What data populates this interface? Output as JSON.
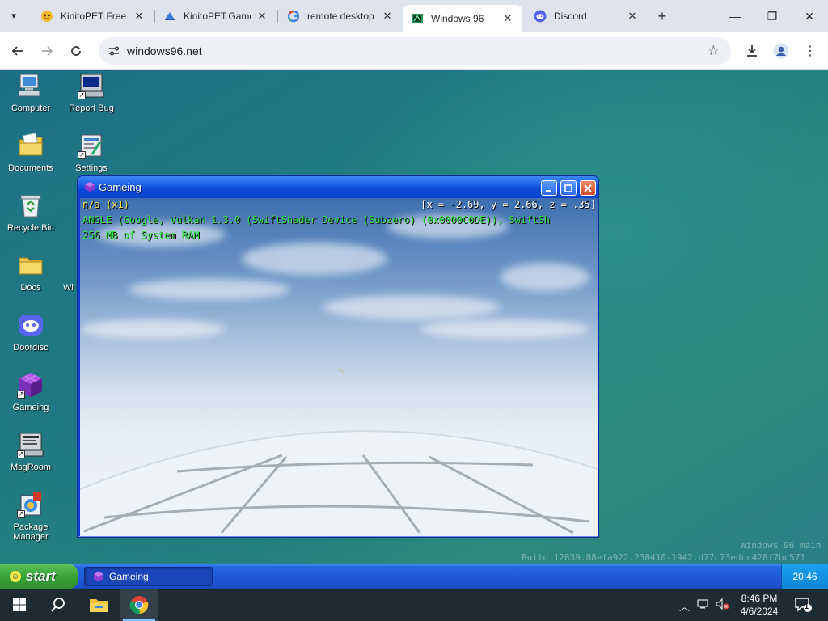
{
  "browser": {
    "tabs": [
      {
        "title": "KinitoPET Free",
        "icon": "kinitopet-favicon"
      },
      {
        "title": "KinitoPET.Game",
        "icon": "cloud-favicon"
      },
      {
        "title": "remote desktop",
        "icon": "google-favicon"
      },
      {
        "title": "Windows 96",
        "icon": "windows96-favicon",
        "active": true
      },
      {
        "title": "Discord",
        "icon": "discord-favicon"
      }
    ],
    "url": "windows96.net"
  },
  "desktop": {
    "icons": [
      {
        "label": "Computer",
        "icon": "computer-icon"
      },
      {
        "label": "Report Bug",
        "icon": "report-bug-icon"
      },
      {
        "label": "Documents",
        "icon": "documents-folder-icon"
      },
      {
        "label": "Settings",
        "icon": "settings-icon"
      },
      {
        "label": "Recycle Bin",
        "icon": "recycle-bin-icon"
      },
      {
        "label": "Docs",
        "icon": "folder-icon"
      },
      {
        "label": "Wi",
        "icon": "hidden-icon"
      },
      {
        "label": "Doordisc",
        "icon": "doordisc-icon"
      },
      {
        "label": "Gameing",
        "icon": "gameing-cube-icon"
      },
      {
        "label": "MsgRoom",
        "icon": "msgroom-icon"
      },
      {
        "label": "Package\nManager",
        "icon": "package-manager-icon"
      }
    ],
    "watermark": {
      "line1": "Windows 96 main",
      "line2": "Build 12839.88efa922.230410-1942.d77c73edcc428f7bc571"
    }
  },
  "game_window": {
    "title": "Gameing",
    "hud": {
      "mode": "n/a (x1)",
      "coords": "[x = -2.69, y = 2.66, z = .35]",
      "renderer": "ANGLE (Google, Vulkan 1.3.0 (SwiftShader Device (Subzero) (0x0000C0DE)), SwiftSh",
      "ram": "256 MB of System RAM"
    }
  },
  "w96_taskbar": {
    "start_label": "start",
    "task_item": "Gameing",
    "clock": "20:46"
  },
  "host_taskbar": {
    "time": "8:46 PM",
    "date": "4/6/2024",
    "notification_count": "1"
  },
  "colors": {
    "hud_yellow": "#f5e94a",
    "hud_green": "#33e640",
    "xp_blue": "#0a44cc",
    "start_green": "#3aa53a"
  }
}
